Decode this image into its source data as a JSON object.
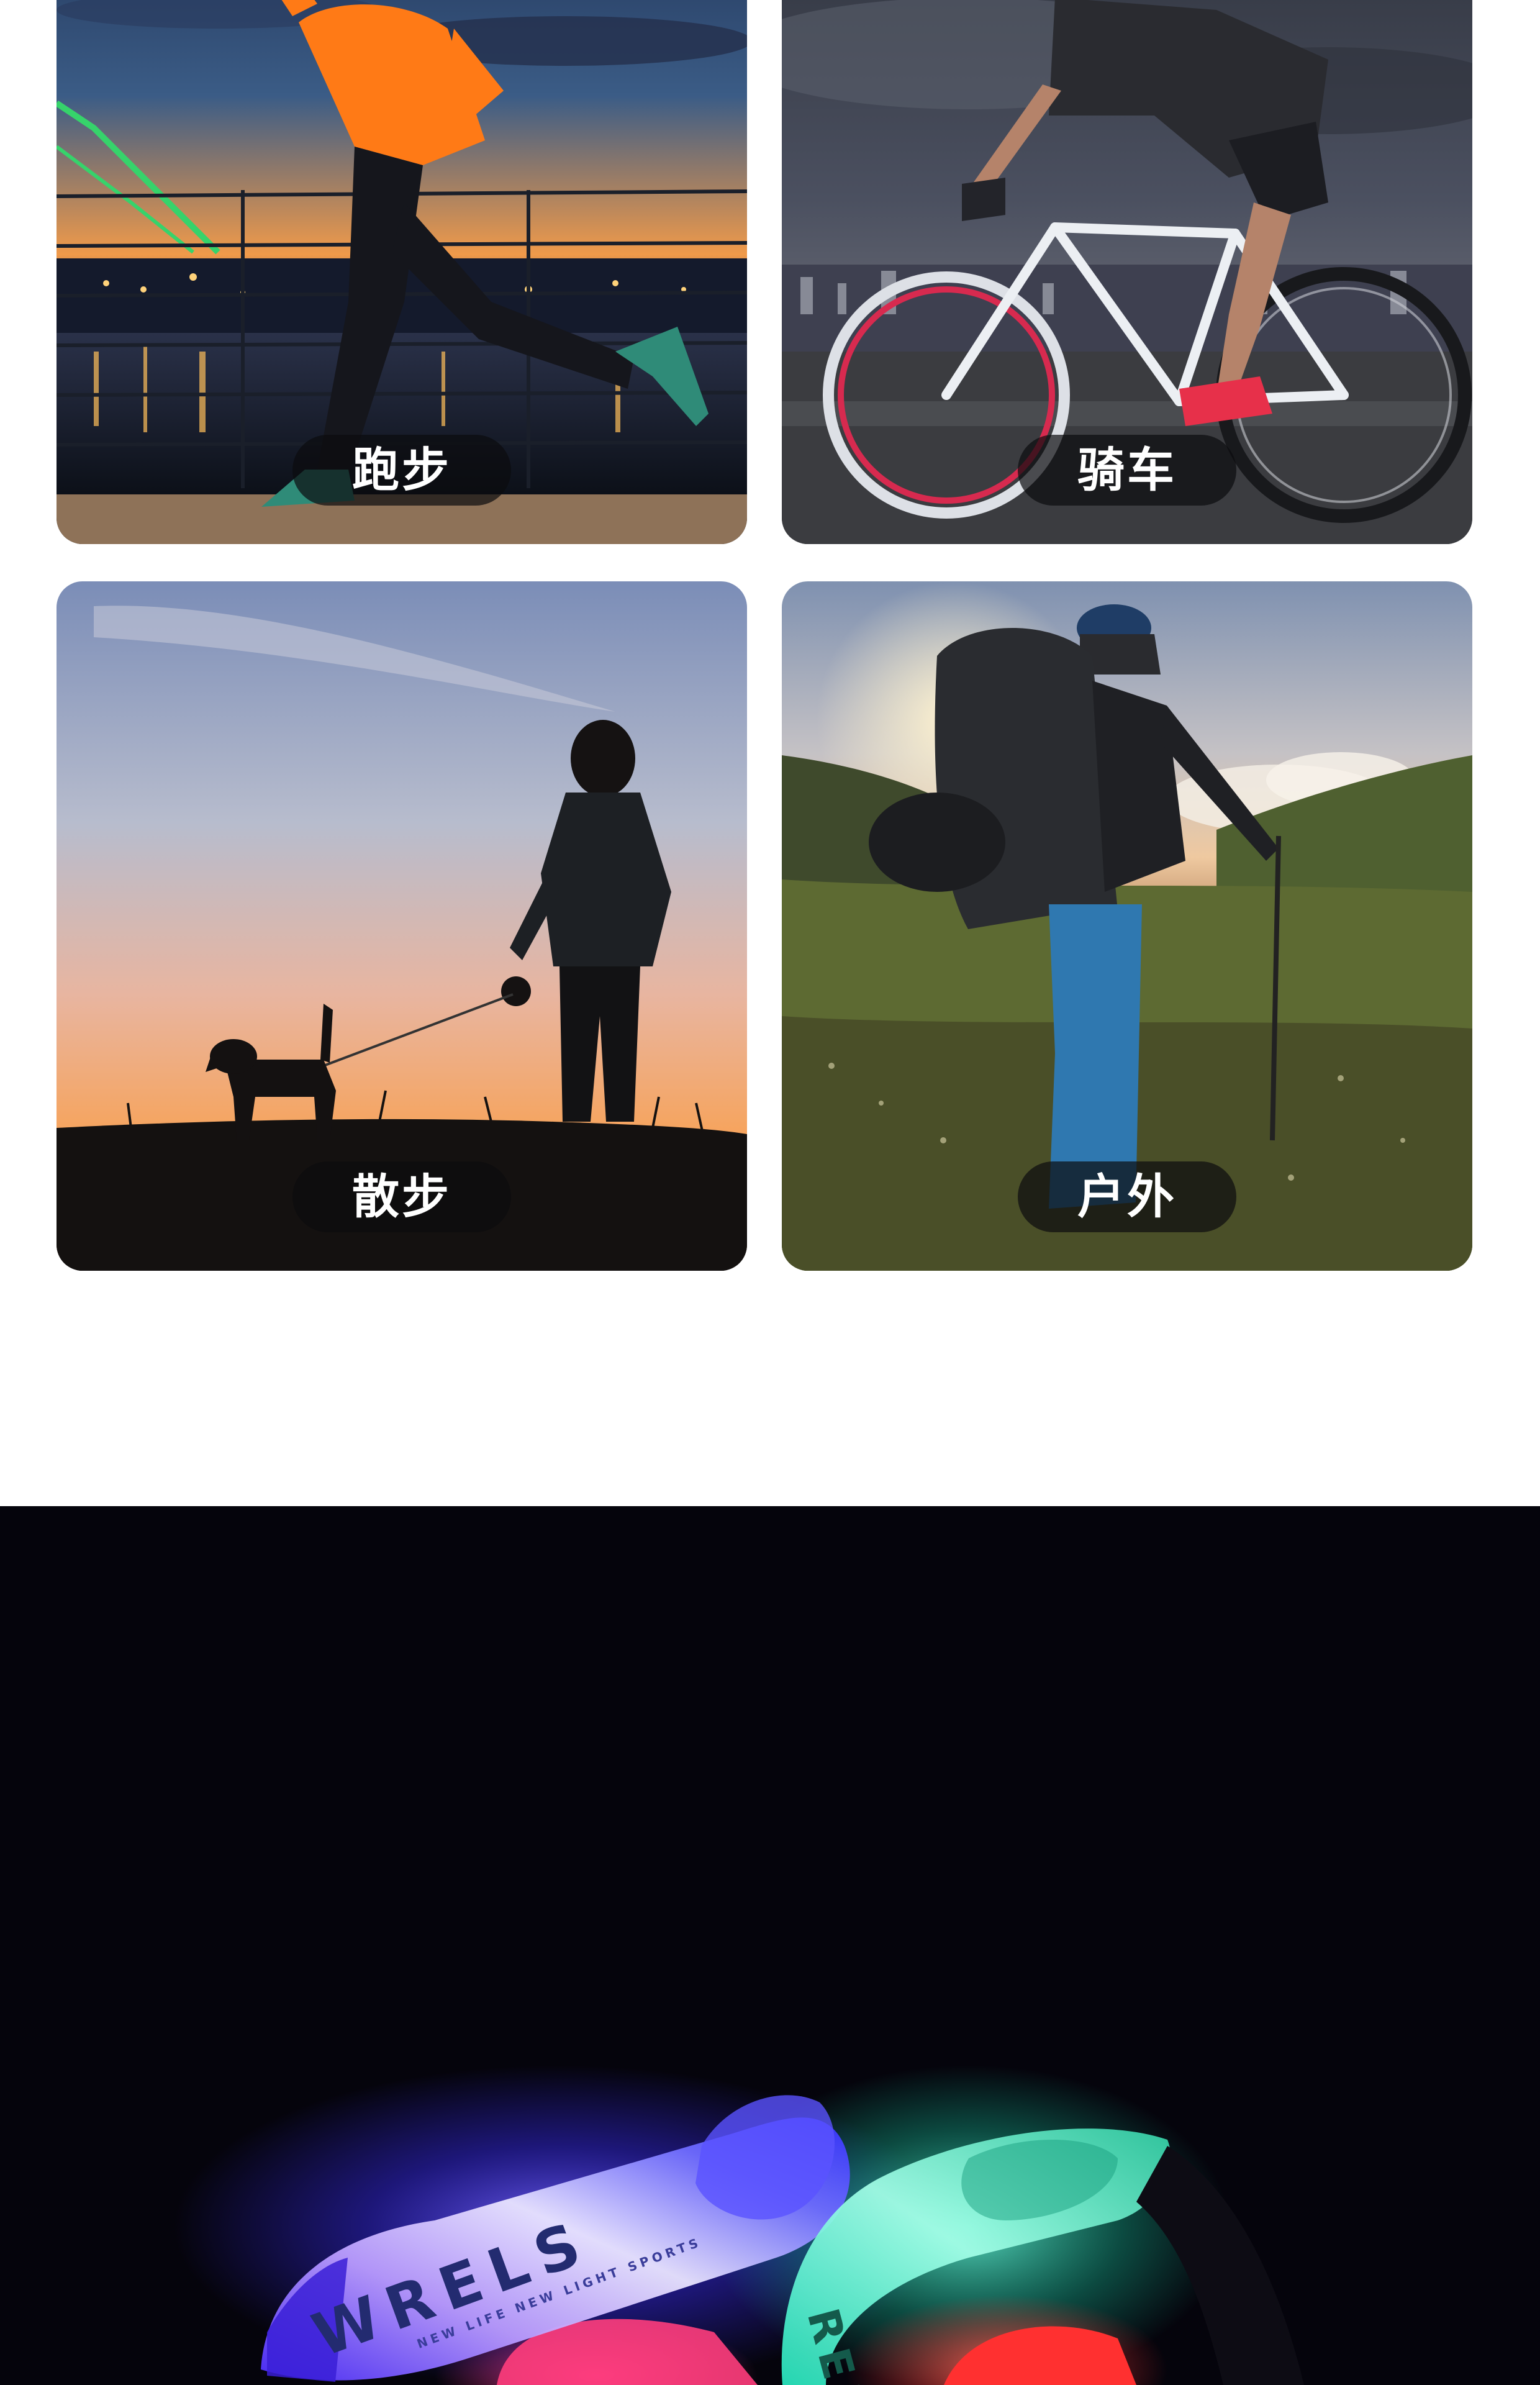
{
  "scenes": [
    {
      "id": "running",
      "label": "跑步"
    },
    {
      "id": "cycling",
      "label": "骑车"
    },
    {
      "id": "walking",
      "label": "散步"
    },
    {
      "id": "outdoor",
      "label": "户外"
    }
  ],
  "product": {
    "brand_text": "WRELS",
    "tagline_text": "NEW LIFE NEW LIGHT SPORTS",
    "second_band_text": "RELS"
  },
  "colors": {
    "section_bg": "#05040c",
    "pill_bg": "rgba(12,12,14,0.70)",
    "blue_band": "#3f3cff",
    "pink_glow": "#ff2e7a",
    "teal_band": "#2ef0c0",
    "red_band": "#ff2a2a"
  }
}
